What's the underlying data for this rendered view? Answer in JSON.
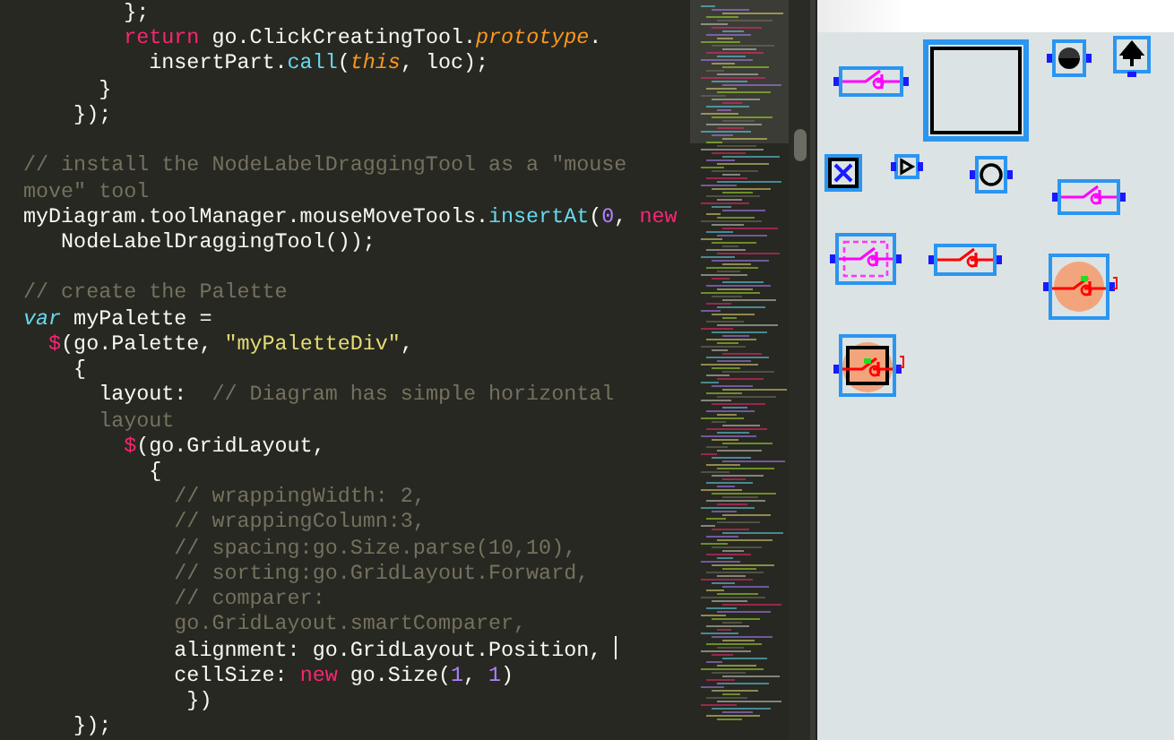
{
  "editor": {
    "lines": [
      {
        "kind": "code",
        "cursor": false,
        "tokens": [
          {
            "text": "        };",
            "kind": "plain"
          }
        ]
      },
      {
        "kind": "code",
        "cursor": false,
        "tokens": [
          {
            "text": "        return",
            "kind": "keyword"
          },
          {
            "text": " go.ClickCreatingTool.",
            "kind": "plain"
          },
          {
            "text": "prototype",
            "kind": "italic"
          },
          {
            "text": ".",
            "kind": "plain"
          }
        ]
      },
      {
        "kind": "code",
        "cursor": false,
        "tokens": [
          {
            "text": "          insertPart.",
            "kind": "plain"
          },
          {
            "text": "call",
            "kind": "call"
          },
          {
            "text": "(",
            "kind": "plain"
          },
          {
            "text": "this",
            "kind": "italic"
          },
          {
            "text": ", loc);",
            "kind": "plain"
          }
        ]
      },
      {
        "kind": "code",
        "cursor": false,
        "tokens": [
          {
            "text": "      }",
            "kind": "plain"
          }
        ]
      },
      {
        "kind": "code",
        "cursor": false,
        "tokens": [
          {
            "text": "    });",
            "kind": "plain"
          }
        ]
      },
      {
        "kind": "blank"
      },
      {
        "kind": "code",
        "cursor": false,
        "tokens": [
          {
            "text": "// install the NodeLabelDraggingTool as a \"mouse",
            "kind": "comment"
          }
        ]
      },
      {
        "kind": "code",
        "cursor": false,
        "tokens": [
          {
            "text": "move\" tool",
            "kind": "comment"
          }
        ]
      },
      {
        "kind": "code",
        "cursor": false,
        "tokens": [
          {
            "text": "myDiagram.toolManager.mouseMoveTools.",
            "kind": "plain"
          },
          {
            "text": "insertAt",
            "kind": "call"
          },
          {
            "text": "(",
            "kind": "plain"
          },
          {
            "text": "0",
            "kind": "number"
          },
          {
            "text": ", ",
            "kind": "plain"
          },
          {
            "text": "new",
            "kind": "keyword"
          }
        ]
      },
      {
        "kind": "code",
        "cursor": false,
        "tokens": [
          {
            "text": "   NodeLabelDraggingTool());",
            "kind": "plain"
          }
        ]
      },
      {
        "kind": "blank"
      },
      {
        "kind": "code",
        "cursor": false,
        "tokens": [
          {
            "text": "// create the Palette",
            "kind": "comment"
          }
        ]
      },
      {
        "kind": "code",
        "cursor": false,
        "tokens": [
          {
            "text": "var",
            "kind": "storage"
          },
          {
            "text": " myPalette =",
            "kind": "plain"
          }
        ]
      },
      {
        "kind": "code",
        "cursor": false,
        "tokens": [
          {
            "text": "  $",
            "kind": "keyword"
          },
          {
            "text": "(go.Palette, ",
            "kind": "plain"
          },
          {
            "text": "\"myPaletteDiv\"",
            "kind": "string"
          },
          {
            "text": ",",
            "kind": "plain"
          }
        ]
      },
      {
        "kind": "code",
        "cursor": false,
        "tokens": [
          {
            "text": "    {",
            "kind": "plain"
          }
        ]
      },
      {
        "kind": "code",
        "cursor": false,
        "tokens": [
          {
            "text": "      layout:  ",
            "kind": "plain"
          },
          {
            "text": "// Diagram has simple horizontal",
            "kind": "comment"
          }
        ]
      },
      {
        "kind": "code",
        "cursor": false,
        "tokens": [
          {
            "text": "      layout",
            "kind": "comment"
          }
        ]
      },
      {
        "kind": "code",
        "cursor": false,
        "tokens": [
          {
            "text": "        $",
            "kind": "keyword"
          },
          {
            "text": "(go.GridLayout,",
            "kind": "plain"
          }
        ]
      },
      {
        "kind": "code",
        "cursor": false,
        "tokens": [
          {
            "text": "          {",
            "kind": "plain"
          }
        ]
      },
      {
        "kind": "code",
        "cursor": false,
        "tokens": [
          {
            "text": "            // wrappingWidth: 2,",
            "kind": "comment"
          }
        ]
      },
      {
        "kind": "code",
        "cursor": false,
        "tokens": [
          {
            "text": "            // wrappingColumn:3,",
            "kind": "comment"
          }
        ]
      },
      {
        "kind": "code",
        "cursor": false,
        "tokens": [
          {
            "text": "            // spacing:go.Size.parse(10,10),",
            "kind": "comment"
          }
        ]
      },
      {
        "kind": "code",
        "cursor": false,
        "tokens": [
          {
            "text": "            // sorting:go.GridLayout.Forward,",
            "kind": "comment"
          }
        ]
      },
      {
        "kind": "code",
        "cursor": false,
        "tokens": [
          {
            "text": "            // comparer:",
            "kind": "comment"
          }
        ]
      },
      {
        "kind": "code",
        "cursor": false,
        "tokens": [
          {
            "text": "            go.GridLayout.smartComparer,",
            "kind": "comment"
          }
        ]
      },
      {
        "kind": "code",
        "cursor": true,
        "tokens": [
          {
            "text": "            alignment: go.GridLayout.Position, ",
            "kind": "plain"
          }
        ]
      },
      {
        "kind": "code",
        "cursor": false,
        "tokens": [
          {
            "text": "            cellSize: ",
            "kind": "plain"
          },
          {
            "text": "new",
            "kind": "keyword"
          },
          {
            "text": " go.Size(",
            "kind": "plain"
          },
          {
            "text": "1",
            "kind": "number"
          },
          {
            "text": ", ",
            "kind": "plain"
          },
          {
            "text": "1",
            "kind": "number"
          },
          {
            "text": ")",
            "kind": "plain"
          }
        ]
      },
      {
        "kind": "code",
        "cursor": false,
        "tokens": [
          {
            "text": "             })",
            "kind": "plain"
          }
        ]
      },
      {
        "kind": "code",
        "cursor": false,
        "tokens": [
          {
            "text": "    });",
            "kind": "plain"
          }
        ]
      }
    ]
  },
  "palette": {
    "items": [
      {
        "kind": "switch"
      },
      {
        "kind": "square"
      },
      {
        "kind": "filled-circle"
      },
      {
        "kind": "arrow-terminal"
      },
      {
        "kind": "cross-box"
      },
      {
        "kind": "triangle"
      },
      {
        "kind": "circle"
      },
      {
        "kind": "switch"
      },
      {
        "kind": "dashed-switch"
      },
      {
        "kind": "red-switch"
      },
      {
        "kind": "round-red-switch"
      },
      {
        "kind": "boxed-red-switch"
      }
    ]
  }
}
